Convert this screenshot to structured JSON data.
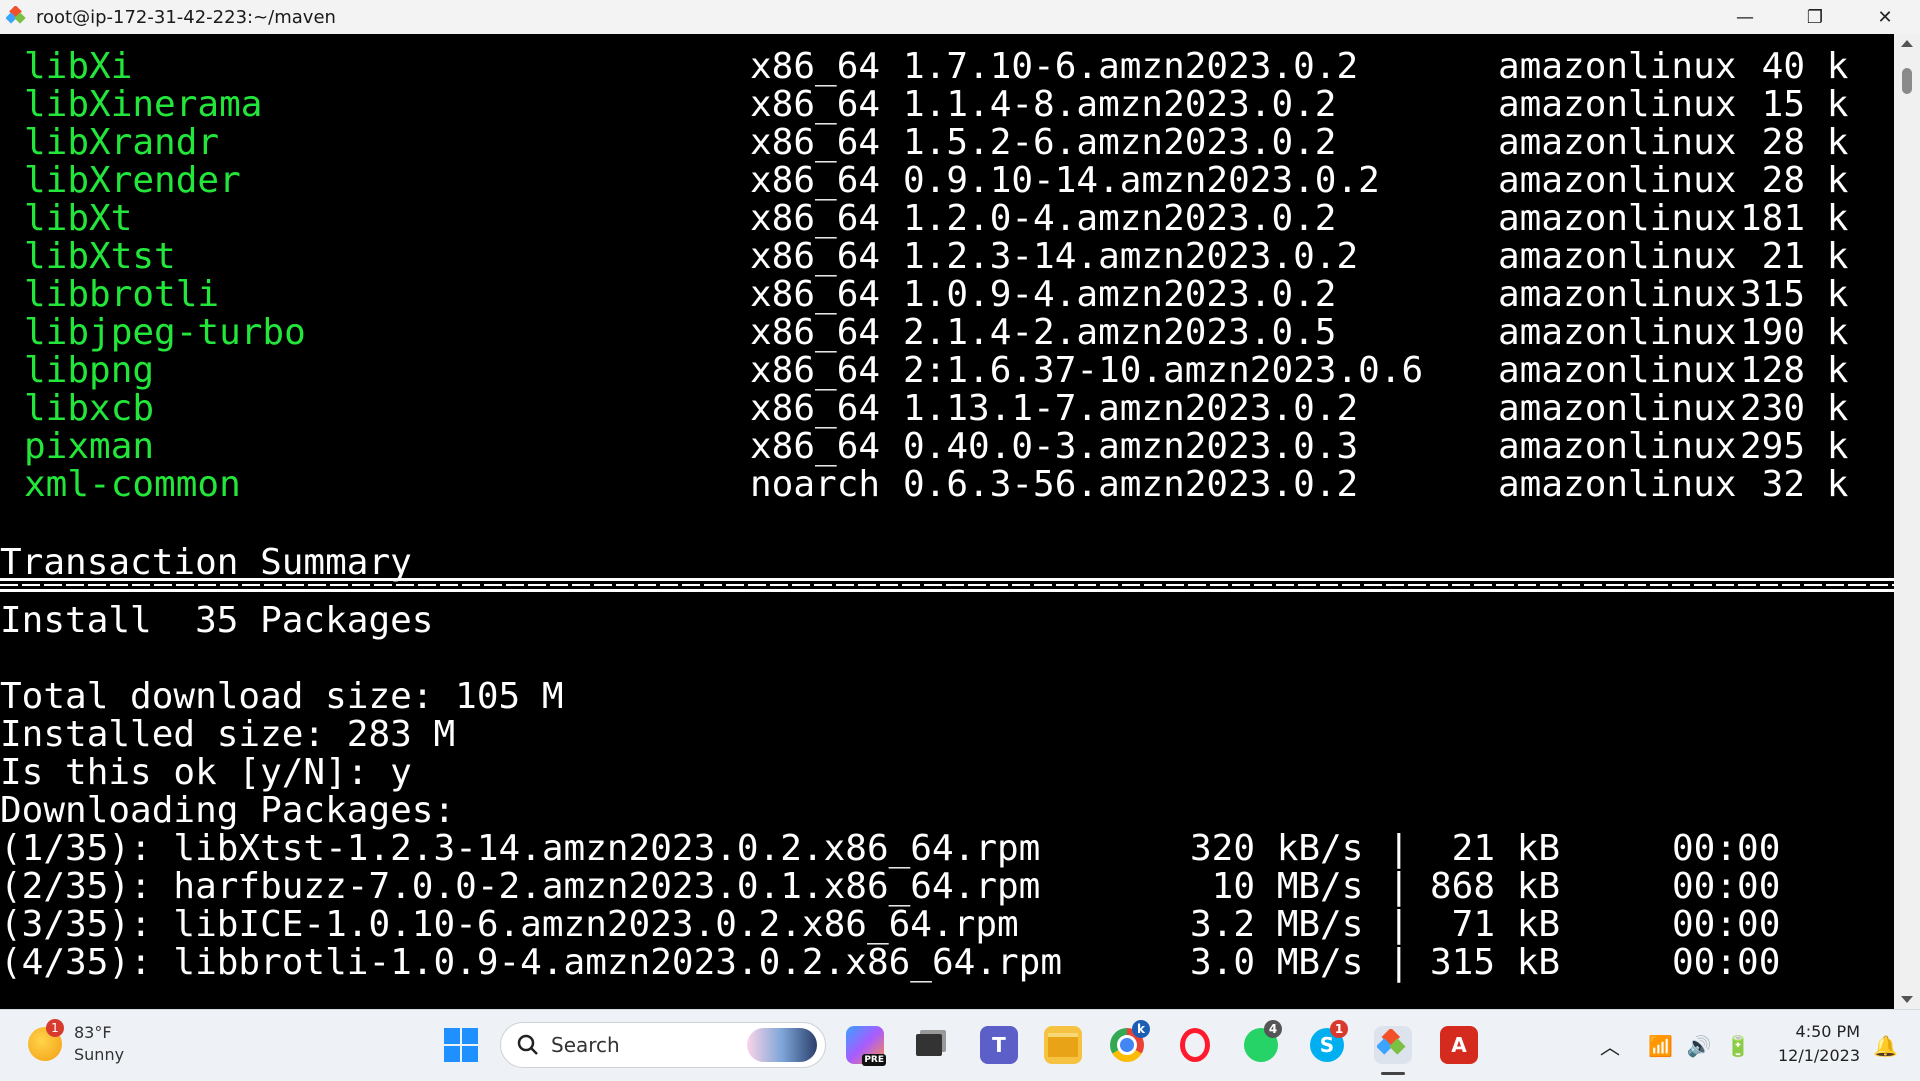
{
  "window": {
    "title": "root@ip-172-31-42-223:~/maven",
    "minimize_symbol": "—",
    "restore_symbol": "❐",
    "close_symbol": "✕"
  },
  "terminal": {
    "packages": [
      {
        "name": "libXi",
        "arch": "x86_64",
        "version": "1.7.10-6.amzn2023.0.2",
        "repo": "amazonlinux",
        "size": " 40 k"
      },
      {
        "name": "libXinerama",
        "arch": "x86_64",
        "version": "1.1.4-8.amzn2023.0.2",
        "repo": "amazonlinux",
        "size": " 15 k"
      },
      {
        "name": "libXrandr",
        "arch": "x86_64",
        "version": "1.5.2-6.amzn2023.0.2",
        "repo": "amazonlinux",
        "size": " 28 k"
      },
      {
        "name": "libXrender",
        "arch": "x86_64",
        "version": "0.9.10-14.amzn2023.0.2",
        "repo": "amazonlinux",
        "size": " 28 k"
      },
      {
        "name": "libXt",
        "arch": "x86_64",
        "version": "1.2.0-4.amzn2023.0.2",
        "repo": "amazonlinux",
        "size": "181 k"
      },
      {
        "name": "libXtst",
        "arch": "x86_64",
        "version": "1.2.3-14.amzn2023.0.2",
        "repo": "amazonlinux",
        "size": " 21 k"
      },
      {
        "name": "libbrotli",
        "arch": "x86_64",
        "version": "1.0.9-4.amzn2023.0.2",
        "repo": "amazonlinux",
        "size": "315 k"
      },
      {
        "name": "libjpeg-turbo",
        "arch": "x86_64",
        "version": "2.1.4-2.amzn2023.0.5",
        "repo": "amazonlinux",
        "size": "190 k"
      },
      {
        "name": "libpng",
        "arch": "x86_64",
        "version": "2:1.6.37-10.amzn2023.0.6",
        "repo": "amazonlinux",
        "size": "128 k"
      },
      {
        "name": "libxcb",
        "arch": "x86_64",
        "version": "1.13.1-7.amzn2023.0.2",
        "repo": "amazonlinux",
        "size": "230 k"
      },
      {
        "name": "pixman",
        "arch": "x86_64",
        "version": "0.40.0-3.amzn2023.0.3",
        "repo": "amazonlinux",
        "size": "295 k"
      },
      {
        "name": "xml-common",
        "arch": "noarch",
        "version": "0.6.3-56.amzn2023.0.2",
        "repo": "amazonlinux",
        "size": " 32 k"
      }
    ],
    "summary_heading": "Transaction Summary",
    "install_line": "Install  35 Packages",
    "total_download": "Total download size: 105 M",
    "installed_size": "Installed size: 283 M",
    "prompt": "Is this ok [y/N]: y",
    "downloading": "Downloading Packages:",
    "downloads": [
      {
        "name": "(1/35): libXtst-1.2.3-14.amzn2023.0.2.x86_64.rpm",
        "rate": "320 kB/s",
        "size": " 21 kB",
        "time": "00:00"
      },
      {
        "name": "(2/35): harfbuzz-7.0.0-2.amzn2023.0.1.x86_64.rpm",
        "rate": " 10 MB/s",
        "size": "868 kB",
        "time": "00:00"
      },
      {
        "name": "(3/35): libICE-1.0.10-6.amzn2023.0.2.x86_64.rpm",
        "rate": "3.2 MB/s",
        "size": " 71 kB",
        "time": "00:00"
      },
      {
        "name": "(4/35): libbrotli-1.0.9-4.amzn2023.0.2.x86_64.rpm",
        "rate": "3.0 MB/s",
        "size": "315 kB",
        "time": "00:00"
      }
    ],
    "colors": {
      "package_name": "#22e63a",
      "text": "#ffffff",
      "background": "#000000"
    }
  },
  "taskbar": {
    "weather": {
      "temp": "83°F",
      "condition": "Sunny",
      "badge": "1"
    },
    "search_placeholder": "Search",
    "copilot_label": "PRE",
    "chrome_badge": "k",
    "whatsapp_badge": "4",
    "skype_badge": "1",
    "clock": {
      "time": "4:50 PM",
      "date": "12/1/2023"
    }
  }
}
